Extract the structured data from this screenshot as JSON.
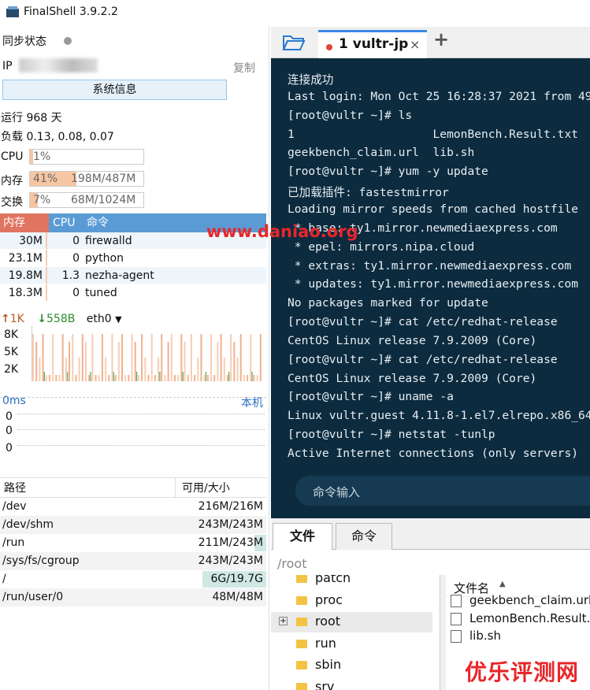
{
  "window": {
    "title": "FinalShell 3.9.2.2"
  },
  "left": {
    "sync_label": "同步状态",
    "ip_label": "IP",
    "copy_label": "复制",
    "sysinfo_label": "系统信息",
    "uptime": "运行 968 天",
    "load": "负载 0.13, 0.08, 0.07",
    "cpu": {
      "label": "CPU",
      "percent": "1%",
      "fill": 0.01
    },
    "mem": {
      "label": "内存",
      "percent": "41%",
      "detail": "198M/487M",
      "fill": 0.41
    },
    "swap": {
      "label": "交换",
      "percent": "7%",
      "detail": "68M/1024M",
      "fill": 0.07
    },
    "proc_headers": {
      "mem": "内存",
      "cpu": "CPU",
      "cmd": "命令"
    },
    "processes": [
      {
        "mem": "30M",
        "cpu": "0",
        "cmd": "firewalld"
      },
      {
        "mem": "23.1M",
        "cpu": "0",
        "cmd": "python"
      },
      {
        "mem": "19.8M",
        "cpu": "1.3",
        "cmd": "nezha-agent"
      },
      {
        "mem": "18.3M",
        "cpu": "0",
        "cmd": "tuned"
      }
    ],
    "net": {
      "up": "1K",
      "down": "558B",
      "iface": "eth0",
      "ticks": [
        "8K",
        "5K",
        "2K"
      ]
    },
    "ping": {
      "label": "0ms",
      "target": "本机",
      "values": [
        "0",
        "0",
        "0"
      ]
    },
    "disk_headers": {
      "path": "路径",
      "size": "可用/大小"
    },
    "disks": [
      {
        "path": "/dev",
        "size": "216M/216M",
        "used": 0.0
      },
      {
        "path": "/dev/shm",
        "size": "243M/243M",
        "used": 0.0
      },
      {
        "path": "/run",
        "size": "211M/243M",
        "used": 0.13
      },
      {
        "path": "/sys/fs/cgroup",
        "size": "243M/243M",
        "used": 0.0
      },
      {
        "path": "/",
        "size": "6G/19.7G",
        "used": 0.7
      },
      {
        "path": "/run/user/0",
        "size": "48M/48M",
        "used": 0.0
      }
    ]
  },
  "tabs": {
    "active_label": "1 vultr-jp",
    "close": "×",
    "add": "+"
  },
  "terminal": {
    "lines": [
      "连接成功",
      "Last login: Mon Oct 25 16:28:37 2021 from 49",
      "[root@vultr ~]# ls",
      "1                    LemonBench.Result.txt",
      "geekbench_claim.url  lib.sh",
      "[root@vultr ~]# yum -y update",
      "已加载插件: fastestmirror",
      "Loading mirror speeds from cached hostfile",
      " * base: ty1.mirror.newmediaexpress.com",
      " * epel: mirrors.nipa.cloud",
      " * extras: ty1.mirror.newmediaexpress.com",
      " * updates: ty1.mirror.newmediaexpress.com",
      "No packages marked for update",
      "[root@vultr ~]# cat /etc/redhat-release",
      "CentOS Linux release 7.9.2009 (Core)",
      "[root@vultr ~]# cat /etc/redhat-release",
      "CentOS Linux release 7.9.2009 (Core)",
      "[root@vultr ~]# uname -a",
      "Linux vultr.guest 4.11.8-1.el7.elrepo.x86_64",
      "[root@vultr ~]# netstat -tunlp",
      "Active Internet connections (only servers)"
    ],
    "input_placeholder": "命令输入"
  },
  "files": {
    "tab_files": "文件",
    "tab_commands": "命令",
    "path": "/root",
    "tree": [
      "patch",
      "proc",
      "root",
      "run",
      "sbin",
      "srv"
    ],
    "list_header": "文件名",
    "list": [
      "geekbench_claim.url",
      "LemonBench.Result.txt",
      "lib.sh"
    ]
  },
  "watermark": "www.daniao.org",
  "brand": "优乐评测网",
  "colors": {
    "accent": "#3b8ae6",
    "terminal_bg": "#0c2b3f",
    "mem_bar": "#f6c6a3",
    "proc_header": "#5a9bd5"
  }
}
